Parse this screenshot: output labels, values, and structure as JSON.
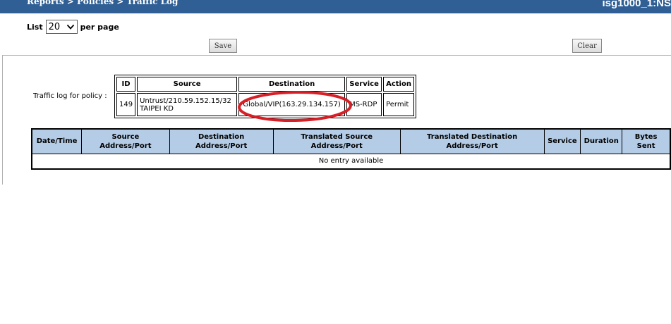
{
  "header": {
    "breadcrumb": "Reports > Policies > Traffic Log",
    "device": "isg1000_1:NS"
  },
  "list": {
    "label": "List",
    "value": "20",
    "suffix": "per page"
  },
  "buttons": {
    "save": "Save",
    "clear": "Clear"
  },
  "policy": {
    "label": "Traffic log for policy :",
    "headers": {
      "id": "ID",
      "source": "Source",
      "destination": "Destination",
      "service": "Service",
      "action": "Action"
    },
    "row": {
      "id": "149",
      "source_line1": "Untrust/210.59.152.15/32",
      "source_line2": "TAIPEI KD",
      "destination": "Global/VIP(163.29.134.157)",
      "service": "MS-RDP",
      "action": "Permit"
    }
  },
  "log": {
    "headers": {
      "datetime": "Date/Time",
      "src_line1": "Source",
      "src_line2": "Address/Port",
      "dst_line1": "Destination",
      "dst_line2": "Address/Port",
      "tsrc_line1": "Translated Source",
      "tsrc_line2": "Address/Port",
      "tdst_line1": "Translated Destination",
      "tdst_line2": "Address/Port",
      "service": "Service",
      "duration": "Duration",
      "bytes_line1": "Bytes",
      "bytes_line2": "Sent"
    },
    "empty_text": "No entry available"
  },
  "colors": {
    "topbar": "#2f5f94",
    "table_header": "#b4cce6",
    "highlight_annotation": "#d61f26"
  }
}
